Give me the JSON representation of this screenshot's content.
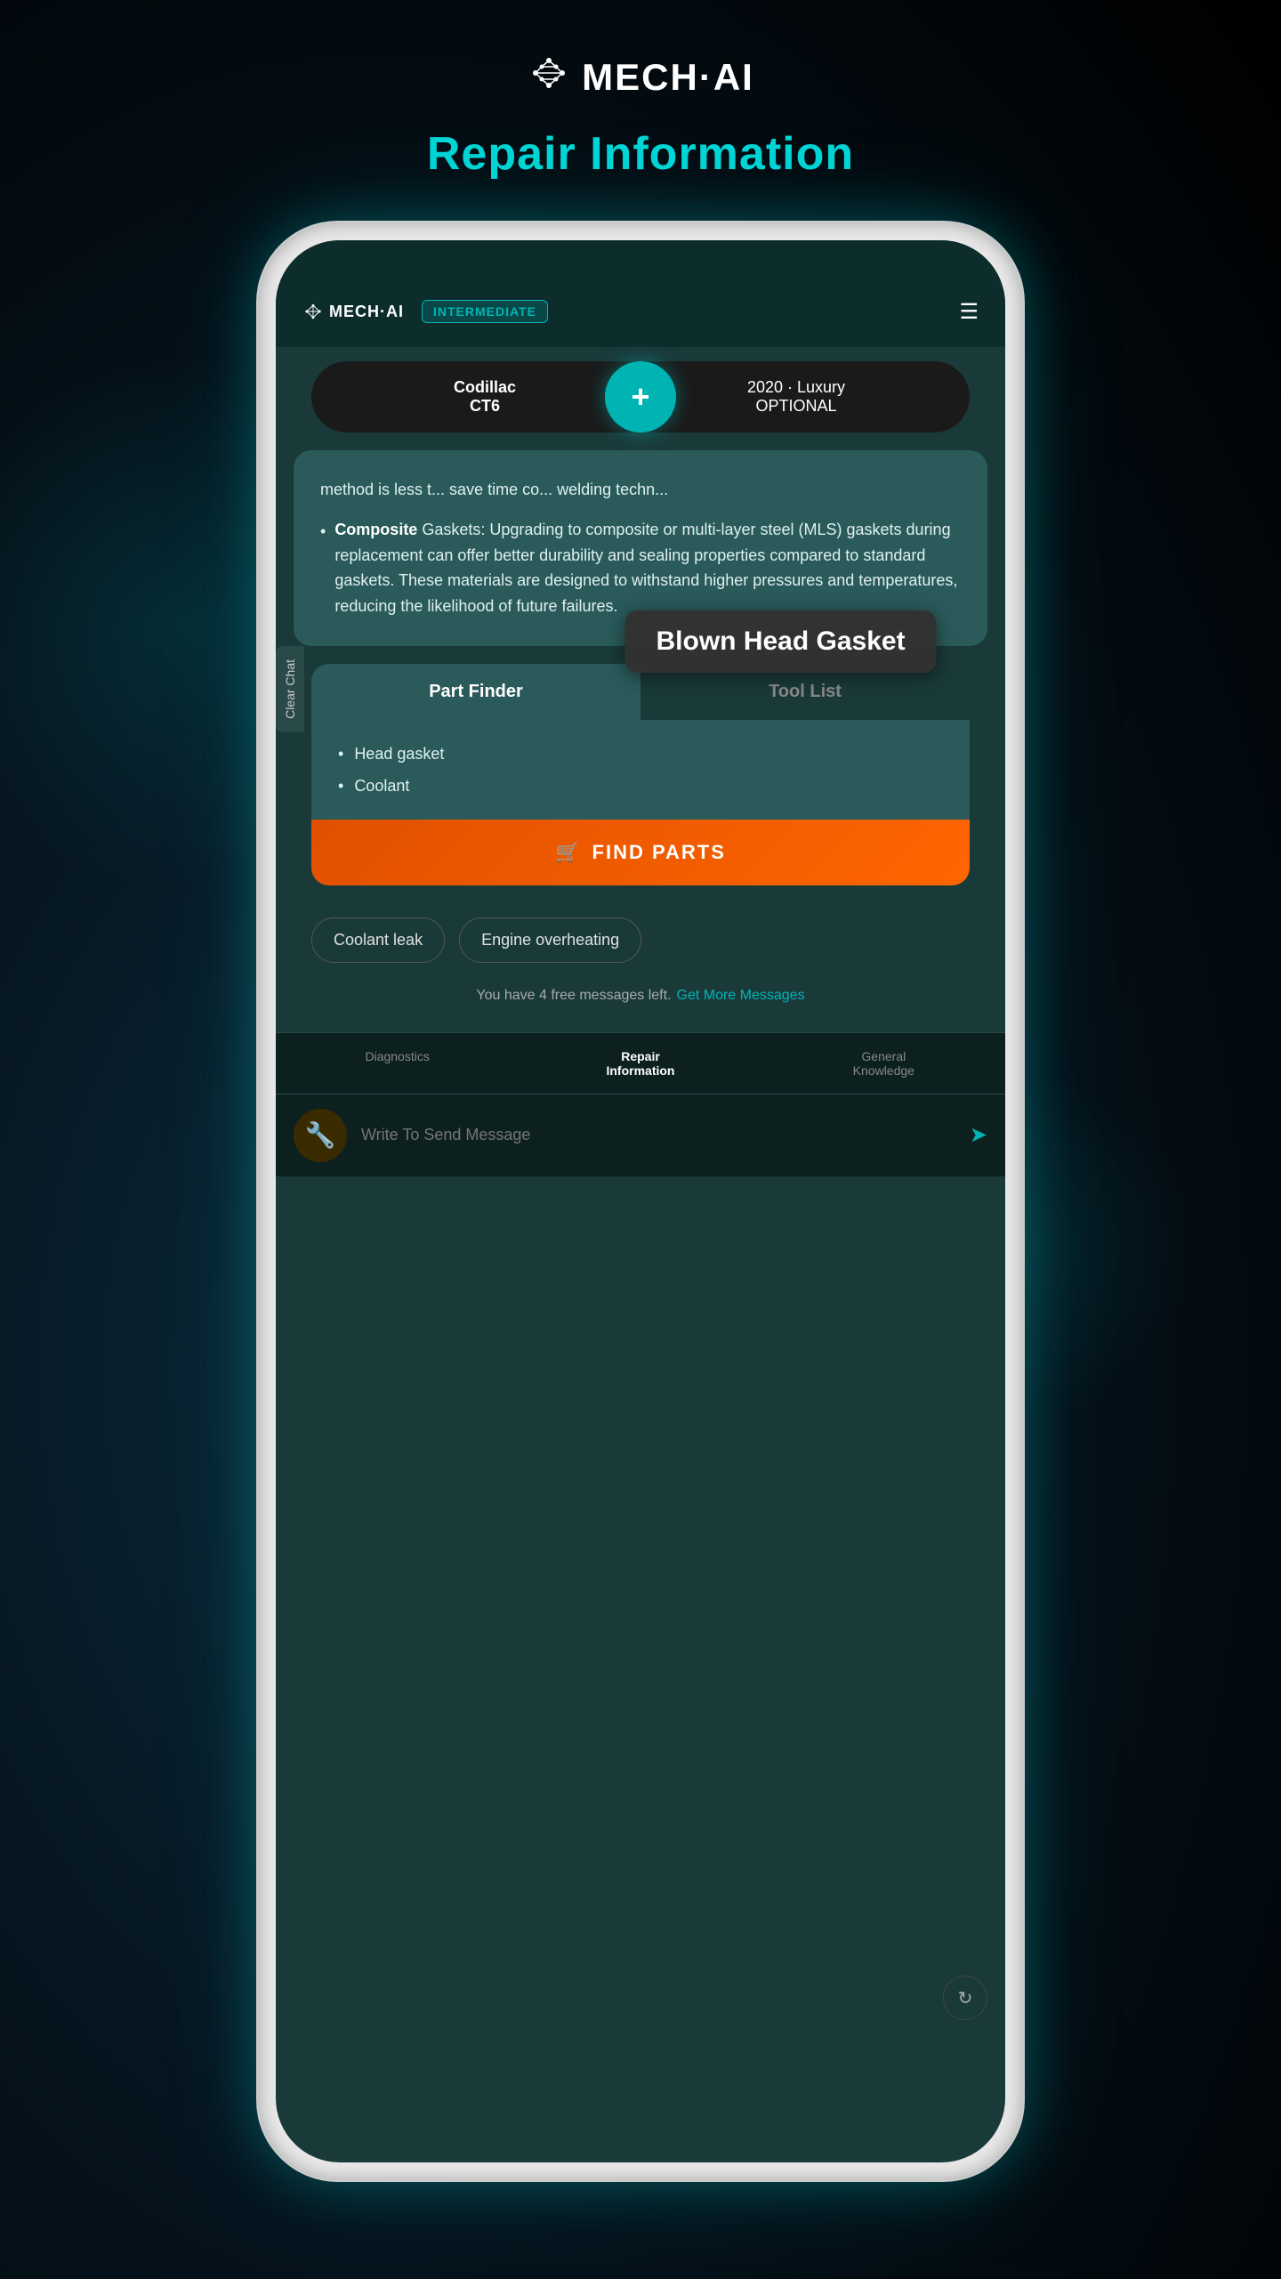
{
  "app": {
    "logo_text": "MECH·AI",
    "page_title": "Repair Information"
  },
  "phone": {
    "nav": {
      "logo_text": "⚙ MECH·AI",
      "badge": "INTERMEDIATE",
      "menu_icon": "☰"
    },
    "vehicle": {
      "make": "Codillac",
      "model": "CT6",
      "year": "2020 · Luxury",
      "trim": "OPTIONAL",
      "plus_icon": "+"
    },
    "sidebar": {
      "label": "Clear Chat"
    },
    "tooltip": {
      "text": "Blown Head Gasket"
    },
    "message": {
      "truncated": "method is less t... save time co... welding techn...",
      "bullet_label": "Composite",
      "bullet_rest": " Gaskets:",
      "bullet_text": " Upgrading to composite or multi-layer steel (MLS) gaskets during replacement can offer better durability and sealing properties compared to standard gaskets. These materials are designed to withstand higher pressures and temperatures, reducing the likelihood of future failures."
    },
    "part_finder": {
      "tab_active": "Part Finder",
      "tab_inactive": "Tool List",
      "parts": [
        "Head gasket",
        "Coolant"
      ],
      "find_parts_label": "FIND PARTS"
    },
    "suggestions": {
      "chips": [
        "Coolant leak",
        "Engine overheating"
      ]
    },
    "message_count": {
      "text": "You have 4 free messages left.",
      "link": "Get More Messages"
    },
    "bottom_nav": {
      "items": [
        "Diagnostics",
        "Repair\nInformation",
        "General\nKnowledge"
      ],
      "active_index": 1
    },
    "input": {
      "placeholder": "Write To Send Message",
      "send_icon": "➤"
    }
  }
}
